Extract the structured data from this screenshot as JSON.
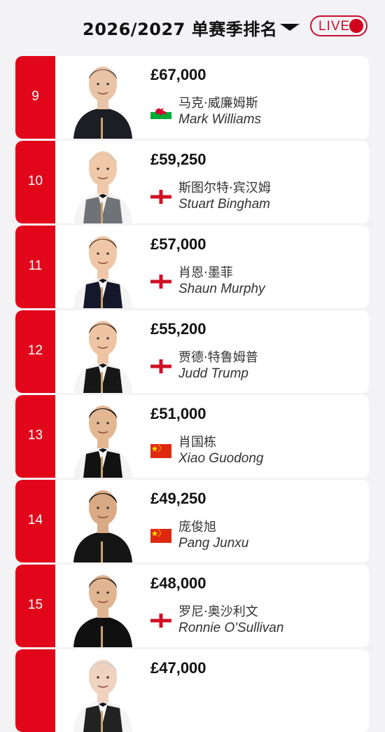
{
  "header": {
    "title": "2026/2027 单赛季排名",
    "live_label": "LIVE"
  },
  "colors": {
    "accent": "#e2061a",
    "live": "#c8102e"
  },
  "players": [
    {
      "rank": "9",
      "prize": "£67,000",
      "name_cn": "马克·威廉姆斯",
      "name_en": "Mark Williams",
      "flag": "wales-flag-icon"
    },
    {
      "rank": "10",
      "prize": "£59,250",
      "name_cn": "斯图尔特·宾汉姆",
      "name_en": "Stuart Bingham",
      "flag": "england-flag-icon"
    },
    {
      "rank": "11",
      "prize": "£57,000",
      "name_cn": "肖恩·墨菲",
      "name_en": "Shaun Murphy",
      "flag": "england-flag-icon"
    },
    {
      "rank": "12",
      "prize": "£55,200",
      "name_cn": "贾德·特鲁姆普",
      "name_en": "Judd Trump",
      "flag": "england-flag-icon"
    },
    {
      "rank": "13",
      "prize": "£51,000",
      "name_cn": "肖国栋",
      "name_en": "Xiao Guodong",
      "flag": "china-flag-icon"
    },
    {
      "rank": "14",
      "prize": "£49,250",
      "name_cn": "庞俊旭",
      "name_en": "Pang Junxu",
      "flag": "china-flag-icon"
    },
    {
      "rank": "15",
      "prize": "£48,000",
      "name_cn": "罗尼·奥沙利文",
      "name_en": "Ronnie O'Sullivan",
      "flag": "england-flag-icon"
    },
    {
      "rank": "",
      "prize": "£47,000",
      "name_cn": "",
      "name_en": "",
      "flag": ""
    }
  ]
}
